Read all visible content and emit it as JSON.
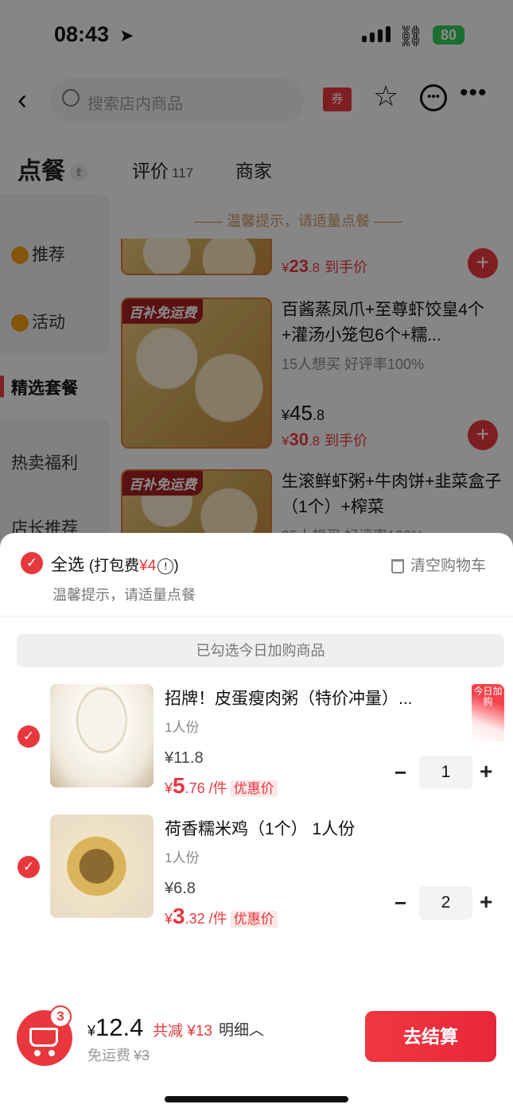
{
  "status": {
    "time": "08:43",
    "battery": "80"
  },
  "header": {
    "search_placeholder": "搜索店内商品",
    "coupon": "券"
  },
  "tabs": {
    "order": "点餐",
    "review": "评价",
    "review_count": "117",
    "shop": "商家"
  },
  "sidebar": {
    "items": [
      {
        "label": "推荐"
      },
      {
        "label": "活动"
      },
      {
        "label": "精选套餐"
      },
      {
        "label": "热卖福利"
      },
      {
        "label": "店长推荐"
      }
    ]
  },
  "menu": {
    "tip": "—— 温馨提示，请适量点餐 ——",
    "items": [
      {
        "deal_symbol": "¥",
        "deal_int": "23",
        "deal_dec": ".8",
        "deal_label": "到手价"
      },
      {
        "tag": "百补免运费",
        "name": "百酱蒸凤爪+至尊虾饺皇4个+灌汤小笼包6个+糯...",
        "meta": "15人想买  好评率100%",
        "price_symbol": "¥",
        "price_int": "45",
        "price_dec": ".8",
        "deal_symbol": "¥",
        "deal_int": "30",
        "deal_dec": ".8",
        "deal_label": "到手价"
      },
      {
        "tag": "百补免运费",
        "name": "生滚鲜虾粥+牛肉饼+韭菜盒子（1个）+榨菜",
        "meta": "25人想买  好评率100%"
      }
    ]
  },
  "cart_sheet": {
    "select_all": "全选",
    "packing_prefix": "(打包费",
    "packing_fee": "¥4",
    "packing_suffix": ")",
    "tip": "温馨提示，请适量点餐",
    "clear": "清空购物车",
    "today_label": "已勾选今日加购商品",
    "items": [
      {
        "ribbon": "今日加购",
        "name": "招牌！皮蛋瘦肉粥（特价冲量）...",
        "serving": "1人份",
        "original": "¥11.8",
        "deal_symbol": "¥",
        "deal_int": "5",
        "deal_dec": ".76",
        "unit": "/件",
        "deal_label": "优惠价",
        "quantity": "1"
      },
      {
        "name": "荷香糯米鸡（1个） 1人份",
        "serving": "1人份",
        "original": "¥6.8",
        "deal_symbol": "¥",
        "deal_int": "3",
        "deal_dec": ".32",
        "unit": "/件",
        "deal_label": "优惠价",
        "quantity": "2"
      }
    ]
  },
  "bottom": {
    "cart_count": "3",
    "total_symbol": "¥",
    "total": "12.4",
    "saved": "共减 ¥13",
    "detail": "明细",
    "free_ship": "免运费",
    "ship_fee": "¥3",
    "checkout": "去结算"
  },
  "colors": {
    "accent": "#e8373d",
    "tip": "#c99563"
  }
}
